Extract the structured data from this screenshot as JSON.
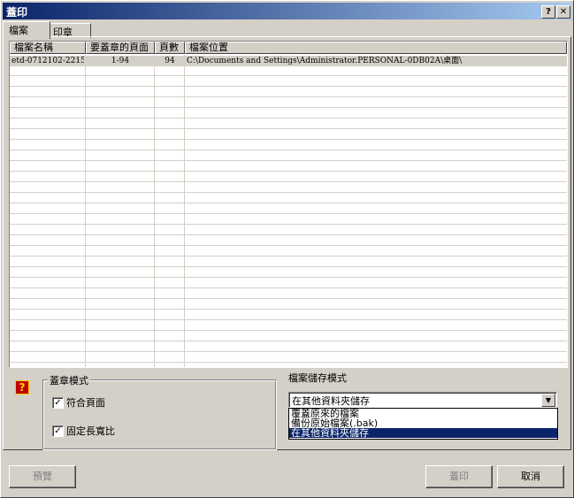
{
  "window": {
    "title": "蓋印",
    "help_button": "?",
    "close_button": "✕"
  },
  "tabs": [
    {
      "label": "檔案",
      "active": true
    },
    {
      "label": "印章",
      "active": false
    }
  ],
  "file_list": {
    "columns": [
      "檔案名稱",
      "要蓋章的頁面",
      "頁數",
      "檔案位置"
    ],
    "rows": [
      {
        "name": "etd-0712102-2215<",
        "pages_to_stamp": "1-94",
        "page_count": "94",
        "location": "C:\\Documents and Settings\\Administrator.PERSONAL-0DB02A\\桌面\\"
      }
    ]
  },
  "stamp_mode": {
    "label": "蓋章模式",
    "options": [
      {
        "label": "符合頁面",
        "checked": true
      },
      {
        "label": "固定長寬比",
        "checked": true
      }
    ]
  },
  "save_mode": {
    "label": "檔案儲存模式",
    "selected": "在其他資料夾儲存",
    "options": [
      "覆蓋原來的檔案",
      "備份原始檔案(.bak)",
      "在其他資料夾儲存"
    ],
    "highlighted_index": 2
  },
  "buttons": {
    "preview": "預覽",
    "stamp": "蓋印",
    "cancel": "取消"
  },
  "colors": {
    "titlebar_start": "#0a246a",
    "titlebar_end": "#a6caf0",
    "selection": "#0a246a",
    "help_icon": "#c00000"
  },
  "icons": {
    "help": "question-mark-icon",
    "dropdown": "chevron-down-icon",
    "check": "checkmark-icon"
  }
}
